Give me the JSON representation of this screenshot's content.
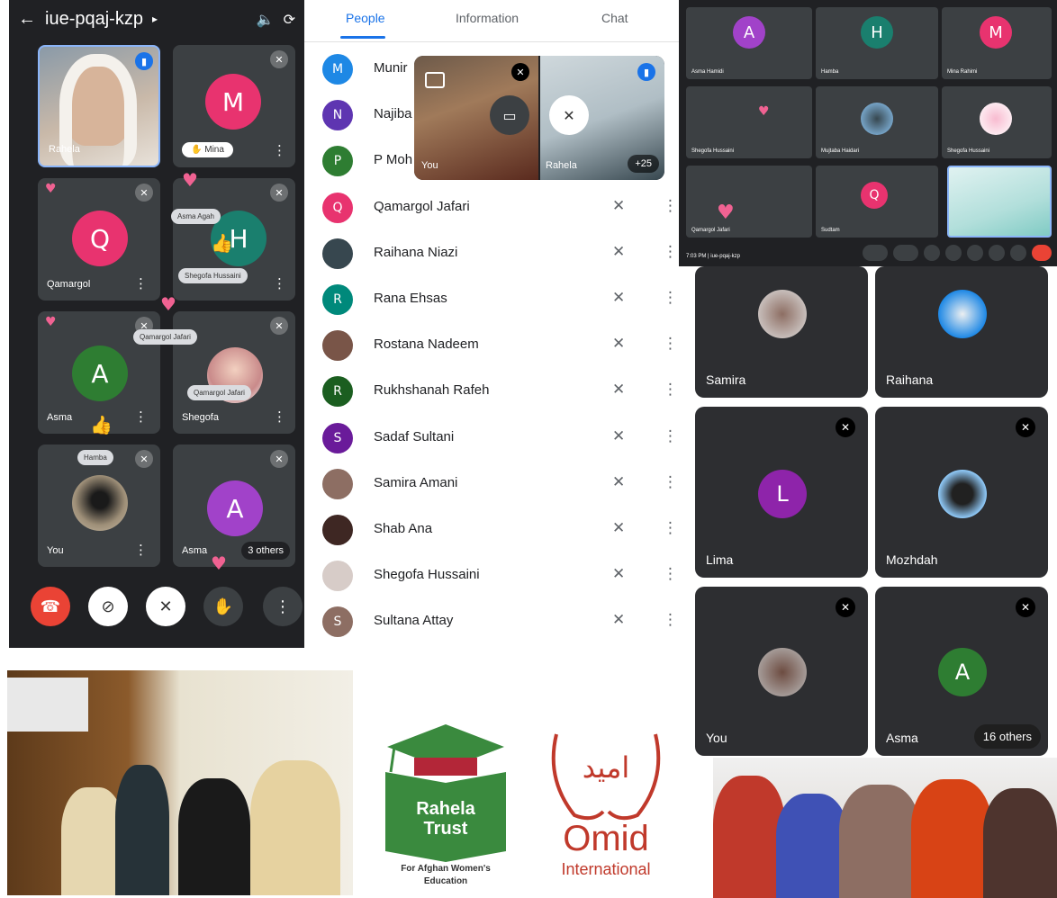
{
  "phone": {
    "title": "iue-pqaj-kzp",
    "back_icon": "arrow-left-icon",
    "tiles": [
      {
        "name": "Rahela"
      },
      {
        "initial": "M",
        "name": "Mina",
        "color": "#e8336f"
      },
      {
        "initial": "Q",
        "name": "Qamargol",
        "color": "#e8336f"
      },
      {
        "initial": "H",
        "name": "Shegofa Hussaini",
        "color": "#1a7f6e"
      },
      {
        "initial": "A",
        "name": "Asma",
        "color": "#2e7d32"
      },
      {
        "name": "Shegofa"
      },
      {
        "name": "You"
      },
      {
        "initial": "A",
        "name": "Asma",
        "others": "3 others",
        "color": "#a142c9"
      }
    ],
    "reactions": [
      "Asma Agah",
      "Qamargol Jafari",
      "Qamargol Jafari",
      "Hamba"
    ],
    "end_call_color": "#ea4335"
  },
  "people": {
    "tabs": [
      "People",
      "Information",
      "Chat"
    ],
    "active_tab_color": "#1a73e8",
    "participants": [
      {
        "initial": "M",
        "name": "Munir",
        "color": "#1e88e5"
      },
      {
        "initial": "N",
        "name": "Najiba",
        "color": "#5e35b1"
      },
      {
        "initial": "P",
        "name": "P Moh",
        "color": "#2e7d32"
      },
      {
        "initial": "Q",
        "name": "Qamargol Jafari",
        "color": "#e8336f"
      },
      {
        "initial": "",
        "name": "Raihana Niazi",
        "color": "#37474f"
      },
      {
        "initial": "R",
        "name": "Rana Ehsas",
        "color": "#00897b"
      },
      {
        "initial": "",
        "name": "Rostana Nadeem",
        "color": "#795548"
      },
      {
        "initial": "R",
        "name": "Rukhshanah Rafeh",
        "color": "#1b5e20"
      },
      {
        "initial": "S",
        "name": "Sadaf Sultani",
        "color": "#6a1b9a"
      },
      {
        "initial": "",
        "name": "Samira Amani",
        "color": "#8d6e63"
      },
      {
        "initial": "",
        "name": "Shab Ana",
        "color": "#3e2723"
      },
      {
        "initial": "",
        "name": "Shegofa Hussaini",
        "color": "#d7ccc8"
      },
      {
        "initial": "S",
        "name": "Sultana Attay",
        "color": "#8d6e63"
      }
    ],
    "overlay": {
      "you": "You",
      "rahela": "Rahela",
      "count": "+25"
    }
  },
  "top_grid": {
    "initials": [
      {
        "initial": "A",
        "color": "#a142c9"
      },
      {
        "initial": "H",
        "color": "#1a7f6e"
      },
      {
        "initial": "M",
        "color": "#e8336f"
      }
    ],
    "small_labels": [
      "Asma Hamidi",
      "Hamba",
      "Mina Rahimi",
      "Shegofa Hussaini",
      "Mujtaba Haidari",
      "Shegofa Hussaini",
      "Qamargol Jafari",
      "Qamargol Jafari",
      "Sudtam"
    ],
    "time": "7:03 PM | iue-pqaj-kzp"
  },
  "big_grid": {
    "tiles": [
      {
        "name": "Samira"
      },
      {
        "name": "Raihana"
      },
      {
        "initial": "L",
        "name": "Lima",
        "color": "#8e24aa"
      },
      {
        "name": "Mozhdah"
      },
      {
        "name": "You"
      },
      {
        "initial": "A",
        "name": "Asma",
        "color": "#2e7d32"
      }
    ],
    "others": "16 others"
  },
  "logos": {
    "rahela_line1": "Rahela",
    "rahela_line2": "Trust",
    "rahela_tagline1": "For Afghan Women's",
    "rahela_tagline2": "Education",
    "rahela_green": "#3a8a3e",
    "rahela_red": "#b32638",
    "omid_script": "امید",
    "omid_name": "Omid",
    "omid_sub": "International",
    "omid_red": "#c0392b"
  }
}
